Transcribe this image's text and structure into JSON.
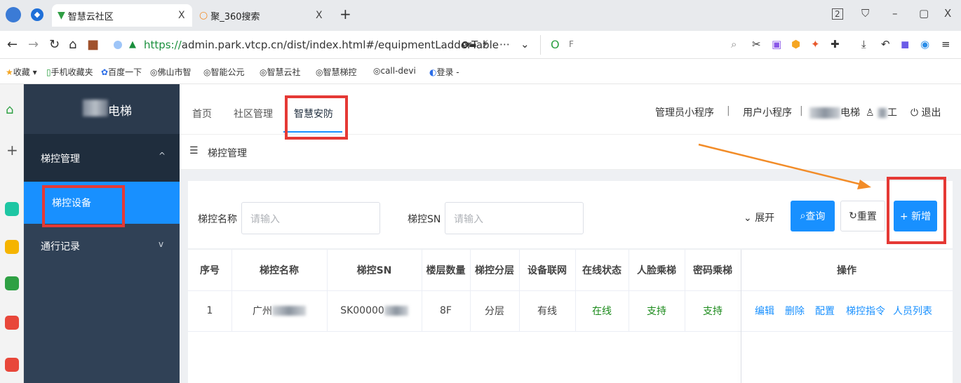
{
  "browser": {
    "tabs": [
      {
        "title": "智慧云社区",
        "close": "X"
      },
      {
        "title": "聚_360搜索",
        "close": "X"
      }
    ],
    "new_tab": "+",
    "tab_count": "2",
    "url_proto": "https://",
    "url_rest": "admin.park.vtcp.cn/dist/index.html#/equipmentLadderTable",
    "search_box": "F",
    "bookmarks": [
      "收藏",
      "手机收藏夹",
      "百度一下",
      "佛山市智",
      "智能公元",
      "智慧云社",
      "智慧梯控",
      "call-devi",
      "登录 -"
    ]
  },
  "app": {
    "logo_text": "电梯",
    "sidebar": {
      "groups": [
        {
          "label": "梯控管理",
          "chevron": "^"
        },
        {
          "label": "通行记录",
          "chevron": "v"
        }
      ],
      "active_item": "梯控设备"
    },
    "topnav": [
      "首页",
      "社区管理",
      "智慧安防"
    ],
    "header_right": {
      "admin_app": "管理员小程序",
      "user_app": "用户小程序",
      "org": "电梯",
      "user": "工",
      "logout": "退出"
    },
    "breadcrumb": "梯控管理"
  },
  "search": {
    "name_label": "梯控名称",
    "name_placeholder": "请输入",
    "sn_label": "梯控SN",
    "sn_placeholder": "请输入",
    "expand": "展开",
    "query": "查询",
    "reset": "重置",
    "add": "+ 新增"
  },
  "table": {
    "headers": [
      "序号",
      "梯控名称",
      "梯控SN",
      "楼层数量",
      "梯控分层",
      "设备联网",
      "在线状态",
      "人脸乘梯",
      "密码乘梯",
      "操作"
    ],
    "rows": [
      {
        "index": "1",
        "name": "广州",
        "sn": "SK00000",
        "floors": "8F",
        "layer": "分层",
        "network": "有线",
        "online": "在线",
        "face": "支持",
        "password": "支持"
      }
    ],
    "actions": [
      "编辑",
      "删除",
      "配置",
      "梯控指令",
      "人员列表"
    ]
  },
  "colors": {
    "accent": "#1890ff",
    "sidebar": "#304156",
    "annotation": "#e53935",
    "ok_green": "#1a8a1a"
  }
}
